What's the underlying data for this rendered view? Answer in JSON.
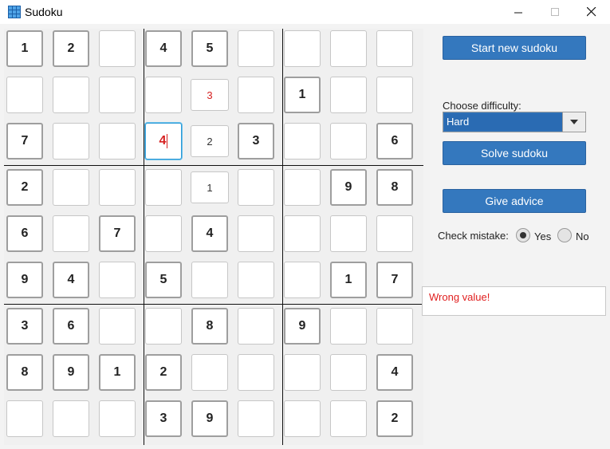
{
  "window": {
    "title": "Sudoku"
  },
  "board": {
    "cells": [
      [
        "1",
        "2",
        "",
        "4",
        "5",
        "",
        "",
        "",
        ""
      ],
      [
        "",
        "",
        "",
        "",
        "3",
        "",
        "1",
        "",
        ""
      ],
      [
        "7",
        "",
        "",
        "4",
        "2",
        "3",
        "",
        "",
        "6"
      ],
      [
        "2",
        "",
        "",
        "",
        "1",
        "",
        "",
        "9",
        "8"
      ],
      [
        "6",
        "",
        "7",
        "",
        "4",
        "",
        "",
        "",
        ""
      ],
      [
        "9",
        "4",
        "",
        "5",
        "",
        "",
        "",
        "1",
        "7"
      ],
      [
        "3",
        "6",
        "",
        "",
        "8",
        "",
        "9",
        "",
        ""
      ],
      [
        "8",
        "9",
        "1",
        "2",
        "",
        "",
        "",
        "",
        "4"
      ],
      [
        "",
        "",
        "",
        "3",
        "9",
        "",
        "",
        "",
        "2"
      ]
    ],
    "given": [
      [
        1,
        1,
        0,
        1,
        1,
        0,
        0,
        0,
        0
      ],
      [
        0,
        0,
        0,
        0,
        0,
        0,
        1,
        0,
        0
      ],
      [
        1,
        0,
        0,
        0,
        0,
        1,
        0,
        0,
        1
      ],
      [
        1,
        0,
        0,
        0,
        0,
        0,
        0,
        1,
        1
      ],
      [
        1,
        0,
        1,
        0,
        1,
        0,
        0,
        0,
        0
      ],
      [
        1,
        1,
        0,
        1,
        0,
        0,
        0,
        1,
        1
      ],
      [
        1,
        1,
        0,
        0,
        1,
        0,
        1,
        0,
        0
      ],
      [
        1,
        1,
        1,
        1,
        0,
        0,
        0,
        0,
        1
      ],
      [
        0,
        0,
        0,
        1,
        1,
        0,
        0,
        0,
        1
      ]
    ],
    "user_entries": [
      {
        "row": 1,
        "col": 4,
        "status": "wrong"
      },
      {
        "row": 2,
        "col": 4,
        "status": "ok"
      },
      {
        "row": 3,
        "col": 4,
        "status": "ok"
      }
    ],
    "focused_cell": {
      "row": 2,
      "col": 3,
      "status": "wrong"
    }
  },
  "controls": {
    "new_button": "Start new sudoku",
    "difficulty_label": "Choose difficulty:",
    "difficulty_value": "Hard",
    "solve_button": "Solve sudoku",
    "advice_button": "Give advice",
    "check_mistake_label": "Check mistake:",
    "yes_label": "Yes",
    "no_label": "No",
    "check_mistake_selected": "Yes",
    "message": "Wrong value!"
  },
  "colors": {
    "accent": "#3478be",
    "error": "#d62020",
    "focus": "#2b9ad6"
  }
}
